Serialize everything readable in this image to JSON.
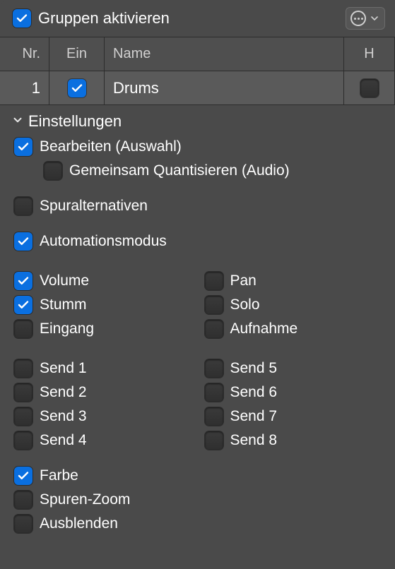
{
  "header": {
    "title": "Gruppen aktivieren",
    "enabled": true
  },
  "columns": {
    "nr": "Nr.",
    "ein": "Ein",
    "name": "Name",
    "h": "H"
  },
  "group": {
    "nr": "1",
    "on": true,
    "name": "Drums",
    "h": false
  },
  "section_title": "Einstellungen",
  "settings": {
    "edit_selection": {
      "label": "Bearbeiten (Auswahl)",
      "checked": true
    },
    "quantize_audio": {
      "label": "Gemeinsam Quantisieren (Audio)",
      "checked": false
    },
    "track_alternatives": {
      "label": "Spuralternativen",
      "checked": false
    },
    "automation_mode": {
      "label": "Automationsmodus",
      "checked": true
    },
    "volume": {
      "label": "Volume",
      "checked": true
    },
    "pan": {
      "label": "Pan",
      "checked": false
    },
    "mute": {
      "label": "Stumm",
      "checked": true
    },
    "solo": {
      "label": "Solo",
      "checked": false
    },
    "input": {
      "label": "Eingang",
      "checked": false
    },
    "record": {
      "label": "Aufnahme",
      "checked": false
    },
    "send1": {
      "label": "Send 1",
      "checked": false
    },
    "send2": {
      "label": "Send 2",
      "checked": false
    },
    "send3": {
      "label": "Send 3",
      "checked": false
    },
    "send4": {
      "label": "Send 4",
      "checked": false
    },
    "send5": {
      "label": "Send 5",
      "checked": false
    },
    "send6": {
      "label": "Send 6",
      "checked": false
    },
    "send7": {
      "label": "Send 7",
      "checked": false
    },
    "send8": {
      "label": "Send 8",
      "checked": false
    },
    "color": {
      "label": "Farbe",
      "checked": true
    },
    "track_zoom": {
      "label": "Spuren-Zoom",
      "checked": false
    },
    "hide": {
      "label": "Ausblenden",
      "checked": false
    }
  }
}
